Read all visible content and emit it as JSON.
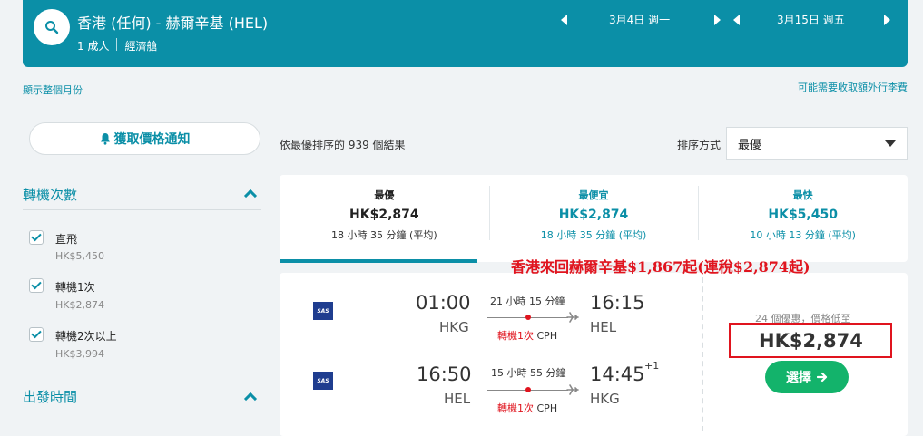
{
  "header": {
    "route": "香港 (任何) - 赫爾辛基 (HEL)",
    "passengers": "1 成人",
    "cabin": "經濟艙",
    "depart_date": "3月4日 週一",
    "return_date": "3月15日 週五"
  },
  "links": {
    "show_month": "顯示整個月份",
    "extra_fees": "可能需要收取額外行李費"
  },
  "sidebar": {
    "price_alert": "獲取價格通知",
    "stops_title": "轉機次數",
    "stops": [
      {
        "label": "直飛",
        "price": "HK$5,450"
      },
      {
        "label": "轉機1次",
        "price": "HK$2,874"
      },
      {
        "label": "轉機2次以上",
        "price": "HK$3,994"
      }
    ],
    "departure_title": "出發時間"
  },
  "results": {
    "count_text": "依最優排序的 939 個結果",
    "sort_label": "排序方式",
    "sort_value": "最優"
  },
  "tabs": [
    {
      "name": "最優",
      "price": "HK$2,874",
      "duration": "18 小時 35 分鐘 (平均)"
    },
    {
      "name": "最便宜",
      "price": "HK$2,874",
      "duration": "18 小時 35 分鐘 (平均)"
    },
    {
      "name": "最快",
      "price": "HK$5,450",
      "duration": "10 小時 13 分鐘 (平均)"
    }
  ],
  "annotation": "香港來回赫爾辛基$1,867起(連稅$2,874起)",
  "flight": {
    "airline_logo": "SAS",
    "outbound": {
      "dep_time": "01:00",
      "dep_code": "HKG",
      "duration": "21 小時 15 分鐘",
      "stops": "轉機1次",
      "via": "CPH",
      "arr_time": "16:15",
      "arr_code": "HEL",
      "day_offset": ""
    },
    "inbound": {
      "dep_time": "16:50",
      "dep_code": "HEL",
      "duration": "15 小時 55 分鐘",
      "stops": "轉機1次",
      "via": "CPH",
      "arr_time": "14:45",
      "arr_code": "HKG",
      "day_offset": "+1"
    },
    "deals_text": "24 個優惠，價格低至",
    "price": "HK$2,874",
    "select_label": "選擇"
  },
  "colors": {
    "accent": "#0b8fa7",
    "cta": "#13b36b",
    "highlight": "#e0141e"
  }
}
